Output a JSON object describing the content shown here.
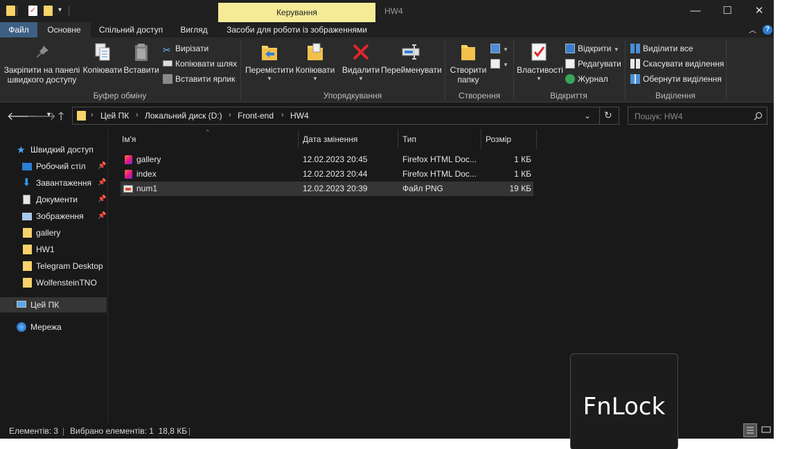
{
  "window": {
    "context_tab": "Керування",
    "title": "HW4",
    "min_glyph": "—",
    "max_glyph": "☐",
    "close_glyph": "✕"
  },
  "tabs": {
    "file": "Файл",
    "home": "Основне",
    "share": "Спільний доступ",
    "view": "Вигляд",
    "picture_tools": "Засоби для роботи із зображеннями"
  },
  "ribbon": {
    "clipboard": {
      "pin_label_1": "Закріпити на панелі",
      "pin_label_2": "швидкого доступу",
      "copy": "Копіювати",
      "paste": "Вставити",
      "cut": "Вирізати",
      "copy_path": "Копіювати шлях",
      "paste_shortcut": "Вставити ярлик",
      "group": "Буфер обміну"
    },
    "organize": {
      "move": "Перемістити",
      "copy": "Копіювати",
      "delete": "Видалити",
      "rename": "Перейменувати",
      "group": "Упорядкування"
    },
    "create": {
      "new_folder_1": "Створити",
      "new_folder_2": "папку",
      "group": "Створення"
    },
    "open": {
      "properties": "Властивості",
      "open": "Відкрити",
      "edit": "Редагувати",
      "history": "Журнал",
      "group": "Відкриття"
    },
    "select": {
      "select_all": "Виділити все",
      "select_none": "Скасувати виділення",
      "invert": "Обернути виділення",
      "group": "Виділення"
    }
  },
  "address": {
    "crumbs": [
      "Цей ПК",
      "Локальний диск (D:)",
      "Front-end",
      "HW4"
    ],
    "search_placeholder": "Пошук: HW4"
  },
  "nav": {
    "quick_access": "Швидкий доступ",
    "items": [
      "Робочий стіл",
      "Завантаження",
      "Документи",
      "Зображення",
      "gallery",
      "HW1",
      "Telegram Desktop",
      "WolfensteinTNO"
    ],
    "this_pc": "Цей ПК",
    "network": "Мережа"
  },
  "columns": {
    "name": "Ім'я",
    "modified": "Дата змінення",
    "type": "Тип",
    "size": "Розмір"
  },
  "files": [
    {
      "name": "gallery",
      "modified": "12.02.2023 20:45",
      "type": "Firefox HTML Doc...",
      "size": "1 КБ",
      "icon": "firefox-html-icon"
    },
    {
      "name": "index",
      "modified": "12.02.2023 20:44",
      "type": "Firefox HTML Doc...",
      "size": "1 КБ",
      "icon": "firefox-html-icon"
    },
    {
      "name": "num1",
      "modified": "12.02.2023 20:39",
      "type": "Файл PNG",
      "size": "19 КБ",
      "icon": "png-file-icon"
    }
  ],
  "status": {
    "items": "Елементів: 3",
    "selected": "Вибрано елементів: 1  18,8 КБ"
  },
  "overlay": {
    "fnlock": "FnLock"
  },
  "colors": {
    "accent_file_tab": "#3d5f84",
    "context_tab": "#f5eb97",
    "background": "#191919",
    "ribbon": "#2b2b2b"
  }
}
